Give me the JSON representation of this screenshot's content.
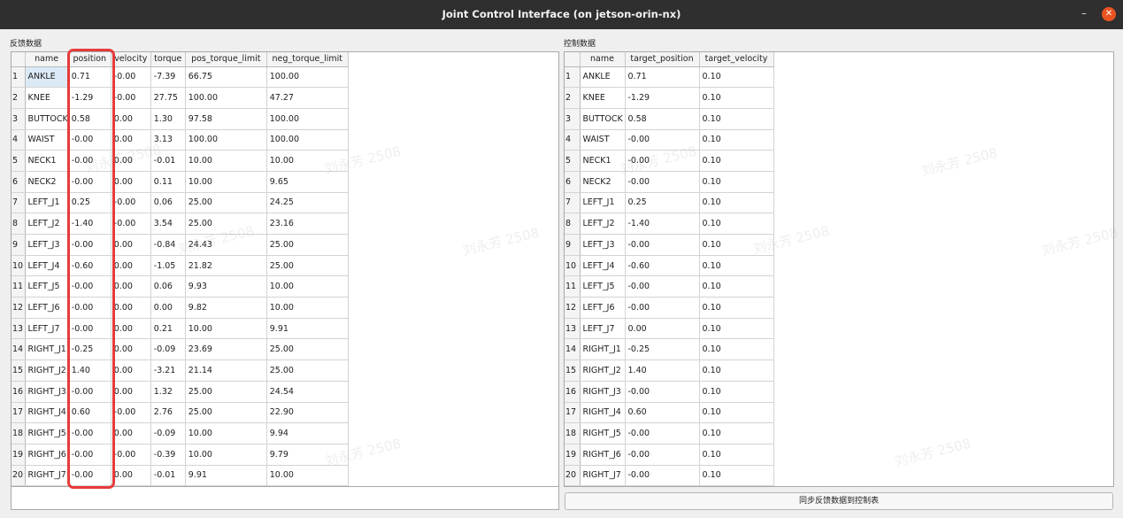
{
  "window": {
    "title": "Joint Control Interface (on jetson-orin-nx)",
    "minimize_glyph": "–",
    "close_glyph": "✕"
  },
  "feedback": {
    "label": "反馈数据",
    "columns": [
      "name",
      "position",
      "velocity",
      "torque",
      "pos_torque_limit",
      "neg_torque_limit"
    ],
    "rows": [
      [
        "ANKLE",
        "0.71",
        "-0.00",
        "-7.39",
        "66.75",
        "100.00"
      ],
      [
        "KNEE",
        "-1.29",
        "-0.00",
        "27.75",
        "100.00",
        "47.27"
      ],
      [
        "BUTTOCK",
        "0.58",
        "0.00",
        "1.30",
        "97.58",
        "100.00"
      ],
      [
        "WAIST",
        "-0.00",
        "0.00",
        "3.13",
        "100.00",
        "100.00"
      ],
      [
        "NECK1",
        "-0.00",
        "0.00",
        "-0.01",
        "10.00",
        "10.00"
      ],
      [
        "NECK2",
        "-0.00",
        "0.00",
        "0.11",
        "10.00",
        "9.65"
      ],
      [
        "LEFT_J1",
        "0.25",
        "-0.00",
        "0.06",
        "25.00",
        "24.25"
      ],
      [
        "LEFT_J2",
        "-1.40",
        "-0.00",
        "3.54",
        "25.00",
        "23.16"
      ],
      [
        "LEFT_J3",
        "-0.00",
        "0.00",
        "-0.84",
        "24.43",
        "25.00"
      ],
      [
        "LEFT_J4",
        "-0.60",
        "0.00",
        "-1.05",
        "21.82",
        "25.00"
      ],
      [
        "LEFT_J5",
        "-0.00",
        "0.00",
        "0.06",
        "9.93",
        "10.00"
      ],
      [
        "LEFT_J6",
        "-0.00",
        "0.00",
        "0.00",
        "9.82",
        "10.00"
      ],
      [
        "LEFT_J7",
        "-0.00",
        "0.00",
        "0.21",
        "10.00",
        "9.91"
      ],
      [
        "RIGHT_J1",
        "-0.25",
        "0.00",
        "-0.09",
        "23.69",
        "25.00"
      ],
      [
        "RIGHT_J2",
        "1.40",
        "0.00",
        "-3.21",
        "21.14",
        "25.00"
      ],
      [
        "RIGHT_J3",
        "-0.00",
        "0.00",
        "1.32",
        "25.00",
        "24.54"
      ],
      [
        "RIGHT_J4",
        "0.60",
        "-0.00",
        "2.76",
        "25.00",
        "22.90"
      ],
      [
        "RIGHT_J5",
        "-0.00",
        "0.00",
        "-0.09",
        "10.00",
        "9.94"
      ],
      [
        "RIGHT_J6",
        "-0.00",
        "-0.00",
        "-0.39",
        "10.00",
        "9.79"
      ],
      [
        "RIGHT_J7",
        "-0.00",
        "0.00",
        "-0.01",
        "9.91",
        "10.00"
      ]
    ]
  },
  "control": {
    "label": "控制数据",
    "columns": [
      "name",
      "target_position",
      "target_velocity"
    ],
    "rows": [
      [
        "ANKLE",
        "0.71",
        "0.10"
      ],
      [
        "KNEE",
        "-1.29",
        "0.10"
      ],
      [
        "BUTTOCK",
        "0.58",
        "0.10"
      ],
      [
        "WAIST",
        "-0.00",
        "0.10"
      ],
      [
        "NECK1",
        "-0.00",
        "0.10"
      ],
      [
        "NECK2",
        "-0.00",
        "0.10"
      ],
      [
        "LEFT_J1",
        "0.25",
        "0.10"
      ],
      [
        "LEFT_J2",
        "-1.40",
        "0.10"
      ],
      [
        "LEFT_J3",
        "-0.00",
        "0.10"
      ],
      [
        "LEFT_J4",
        "-0.60",
        "0.10"
      ],
      [
        "LEFT_J5",
        "-0.00",
        "0.10"
      ],
      [
        "LEFT_J6",
        "-0.00",
        "0.10"
      ],
      [
        "LEFT_J7",
        "0.00",
        "0.10"
      ],
      [
        "RIGHT_J1",
        "-0.25",
        "0.10"
      ],
      [
        "RIGHT_J2",
        "1.40",
        "0.10"
      ],
      [
        "RIGHT_J3",
        "-0.00",
        "0.10"
      ],
      [
        "RIGHT_J4",
        "0.60",
        "0.10"
      ],
      [
        "RIGHT_J5",
        "-0.00",
        "0.10"
      ],
      [
        "RIGHT_J6",
        "-0.00",
        "0.10"
      ],
      [
        "RIGHT_J7",
        "-0.00",
        "0.10"
      ]
    ],
    "sync_button": "同步反馈数据到控制表"
  },
  "watermark": "刘永芳 2508",
  "colors": {
    "highlight_box": "#e63b3b",
    "close_button": "#e95420",
    "titlebar": "#2f2f2f"
  }
}
